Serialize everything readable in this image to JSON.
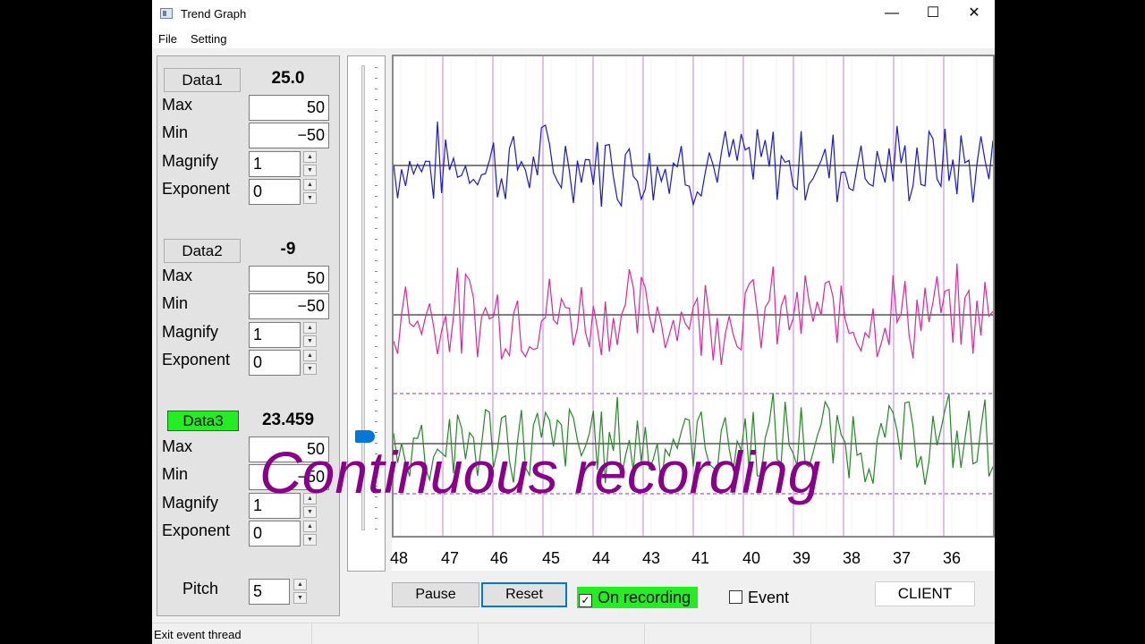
{
  "window": {
    "title": "Trend Graph",
    "controls": {
      "minimize": "—",
      "maximize": "☐",
      "close": "✕"
    }
  },
  "menu": [
    "File",
    "Setting"
  ],
  "channels": [
    {
      "button": "Data1",
      "value": "25.0",
      "max": "50",
      "min": "−50",
      "magnify": "1",
      "exponent": "0",
      "active": false
    },
    {
      "button": "Data2",
      "value": "-9",
      "max": "50",
      "min": "−50",
      "magnify": "1",
      "exponent": "0",
      "active": false
    },
    {
      "button": "Data3",
      "value": "23.459",
      "max": "50",
      "min": "−50",
      "magnify": "1",
      "exponent": "0",
      "active": true
    }
  ],
  "labels": {
    "max": "Max",
    "min": "Min",
    "magnify": "Magnify",
    "exponent": "Exponent",
    "pitch": "Pitch"
  },
  "pitch": "5",
  "graph": {
    "series_colors": [
      "#1a1acc",
      "#d62a9e",
      "#238a23"
    ],
    "grid_color": "#c77ee0",
    "x_ticks": [
      "48",
      "47",
      "46",
      "45",
      "44",
      "43",
      "41",
      "40",
      "39",
      "38",
      "37",
      "36"
    ]
  },
  "controls": {
    "pause": "Pause",
    "reset": "Reset",
    "on_recording": "On recording",
    "on_recording_checked": true,
    "event": "Event",
    "event_checked": false,
    "client": "CLIENT"
  },
  "status": "Exit event thread",
  "overlay_caption": "Continuous recording"
}
